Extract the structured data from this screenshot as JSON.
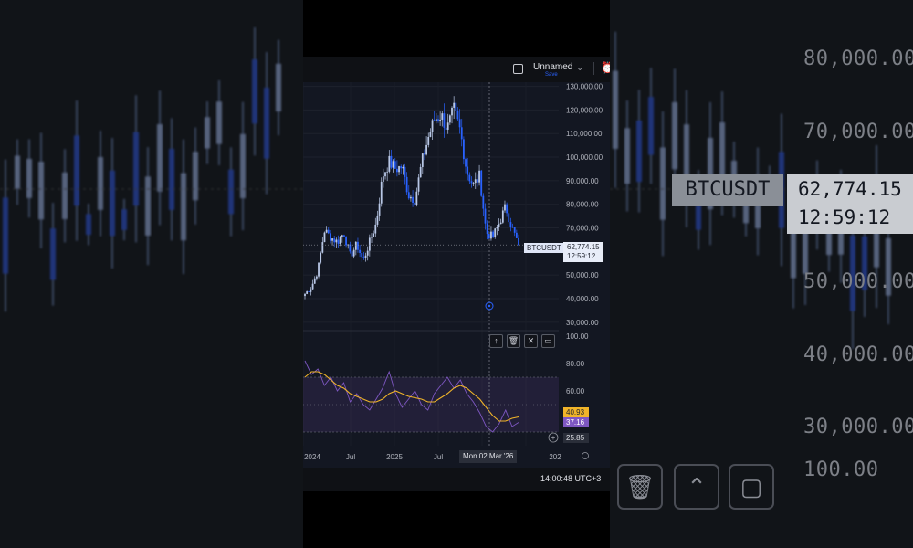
{
  "toolbar": {
    "layout_name": "Unnamed",
    "save_label": "Save",
    "dropdown_icon": "chevron-down-icon",
    "alert_icon": "alarm-clock-icon"
  },
  "symbol": {
    "ticker": "BTCUSDT",
    "last_price": "62,774.15",
    "countdown": "12:59:12"
  },
  "status": {
    "time": "14:00:48 UTC+3"
  },
  "crosshair": {
    "date_label": "Mon 02 Mar '26"
  },
  "rsi": {
    "rsi_value": "37.16",
    "ma_value": "40.93",
    "cursor_value": "25.85",
    "rsi_color": "#7e57c2",
    "ma_color": "#f0b429"
  },
  "drawing_tools": [
    "arrow-up-icon",
    "trash-icon",
    "collapse-icon",
    "fullscreen-icon"
  ],
  "backdrop": {
    "price_labels": [
      "80,000.00",
      "70,000.00",
      "50,000.00",
      "40,000.00",
      "30,000.00",
      "100.00"
    ],
    "ticker": "BTCUSDT",
    "price": "62,774.15",
    "countdown": "12:59:12"
  },
  "colors": {
    "up_candle": "#b8c7e6",
    "down_candle": "#2962ff",
    "background": "#131722",
    "accent": "#2962ff"
  },
  "chart_data": [
    {
      "type": "candlestick",
      "series_name": "BTCUSDT",
      "yticks": [
        130000,
        120000,
        110000,
        100000,
        90000,
        80000,
        70000,
        60000,
        50000,
        40000,
        30000
      ],
      "ytick_labels": [
        "130,000.00",
        "120,000.00",
        "110,000.00",
        "100,000.00",
        "90,000.00",
        "80,000.00",
        "70,000.00",
        "60,000.00",
        "50,000.00",
        "40,000.00",
        "30,000.00"
      ],
      "xtick_labels": [
        "2024",
        "Jul",
        "2025",
        "Jul",
        "202"
      ],
      "ylim": [
        28000,
        131000
      ],
      "close_path": [
        [
          "2024-01",
          42000
        ],
        [
          "2024-02",
          45000
        ],
        [
          "2024-03",
          52000
        ],
        [
          "2024-03-15",
          69000
        ],
        [
          "2024-04",
          66000
        ],
        [
          "2024-05",
          64000
        ],
        [
          "2024-06",
          68000
        ],
        [
          "2024-07",
          58000
        ],
        [
          "2024-08",
          63000
        ],
        [
          "2024-09",
          56000
        ],
        [
          "2024-10",
          64000
        ],
        [
          "2024-11",
          72000
        ],
        [
          "2024-11-20",
          92000
        ],
        [
          "2024-12",
          98000
        ],
        [
          "2025-01",
          95000
        ],
        [
          "2025-02",
          96000
        ],
        [
          "2025-03",
          84000
        ],
        [
          "2025-04",
          82000
        ],
        [
          "2025-05",
          97000
        ],
        [
          "2025-06",
          108000
        ],
        [
          "2025-07",
          116000
        ],
        [
          "2025-08",
          118000
        ],
        [
          "2025-09",
          112000
        ],
        [
          "2025-10",
          120000
        ],
        [
          "2025-10-15",
          111000
        ],
        [
          "2025-11",
          94000
        ],
        [
          "2025-12",
          88000
        ],
        [
          "2026-01",
          92000
        ],
        [
          "2026-02",
          68000
        ],
        [
          "2026-02-20",
          66000
        ],
        [
          "2026-03",
          72000
        ],
        [
          "2026-03-10",
          79000
        ],
        [
          "2026-03-20",
          70000
        ],
        [
          "2026-04",
          62774
        ]
      ]
    },
    {
      "type": "line",
      "name": "RSI",
      "yticks": [
        100,
        80,
        60
      ],
      "ylim": [
        20,
        100
      ],
      "bands": [
        30,
        70
      ],
      "series": [
        {
          "name": "RSI",
          "values": [
            82,
            72,
            76,
            64,
            70,
            60,
            66,
            52,
            58,
            50,
            46,
            54,
            62,
            74,
            58,
            48,
            54,
            60,
            50,
            46,
            58,
            64,
            70,
            62,
            68,
            58,
            52,
            44,
            34,
            30,
            36,
            46,
            34,
            37
          ]
        },
        {
          "name": "RSI-based MA",
          "values": [
            70,
            74,
            74,
            72,
            68,
            64,
            62,
            58,
            56,
            54,
            52,
            52,
            54,
            58,
            60,
            58,
            56,
            55,
            54,
            52,
            52,
            55,
            58,
            62,
            64,
            62,
            58,
            54,
            48,
            42,
            38,
            38,
            40,
            41
          ]
        }
      ]
    }
  ]
}
